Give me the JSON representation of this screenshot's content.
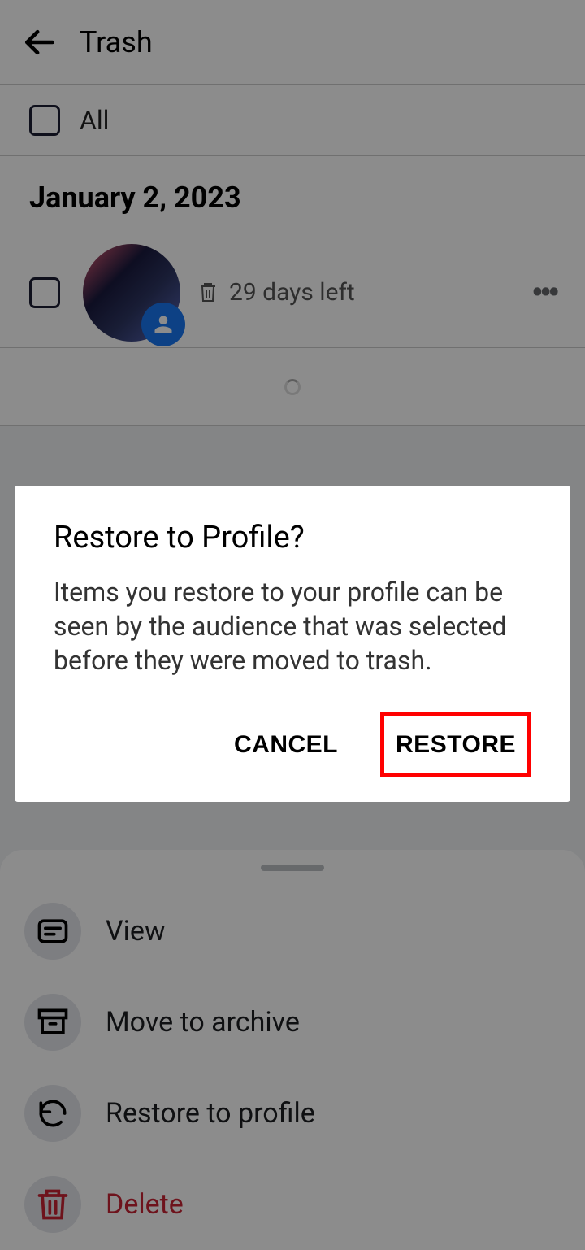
{
  "header": {
    "title": "Trash"
  },
  "filter": {
    "all_label": "All"
  },
  "section": {
    "date": "January 2, 2023",
    "item": {
      "days_left": "29 days left"
    }
  },
  "sheet": {
    "items": [
      {
        "label": "View"
      },
      {
        "label": "Move to archive"
      },
      {
        "label": "Restore to profile"
      },
      {
        "label": "Delete"
      }
    ]
  },
  "dialog": {
    "title": "Restore to Profile?",
    "body": "Items you restore to your profile can be seen by the audience that was selected before they were moved to trash.",
    "cancel": "CANCEL",
    "restore": "RESTORE"
  }
}
